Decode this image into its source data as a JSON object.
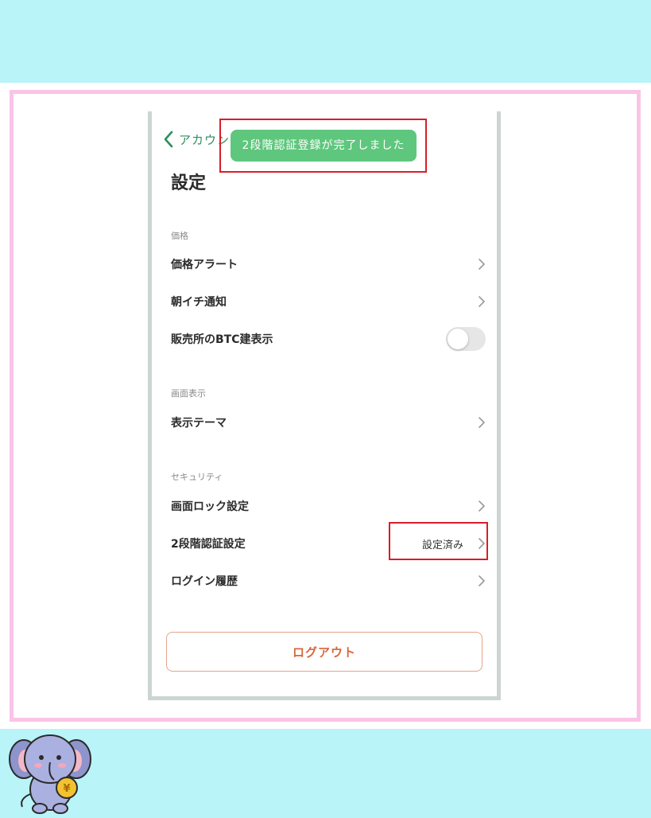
{
  "header": {
    "back_label": "アカウント"
  },
  "toast": {
    "text": "2段階認証登録が完了しました"
  },
  "page": {
    "title": "設定"
  },
  "sections": {
    "price": {
      "header": "価格",
      "price_alert": "価格アラート",
      "morning_notice": "朝イチ通知",
      "btc_display": "販売所のBTC建表示",
      "btc_display_toggle": false
    },
    "display": {
      "header": "画面表示",
      "theme": "表示テーマ"
    },
    "security": {
      "header": "セキュリティ",
      "screen_lock": "画面ロック設定",
      "two_factor": "2段階認証設定",
      "two_factor_value": "設定済み",
      "login_history": "ログイン履歴"
    }
  },
  "logout": {
    "label": "ログアウト"
  },
  "colors": {
    "accent_green": "#5ec77d",
    "back_green": "#2d8e5c",
    "logout_orange": "#d8663a",
    "highlight_red": "#d81e2a",
    "frame_pink": "#f9c4e6",
    "band_cyan": "#b8f4f8"
  },
  "icons": {
    "back": "chevron-left-icon",
    "row": "chevron-right-icon",
    "mascot": "elephant-mascot-icon"
  }
}
